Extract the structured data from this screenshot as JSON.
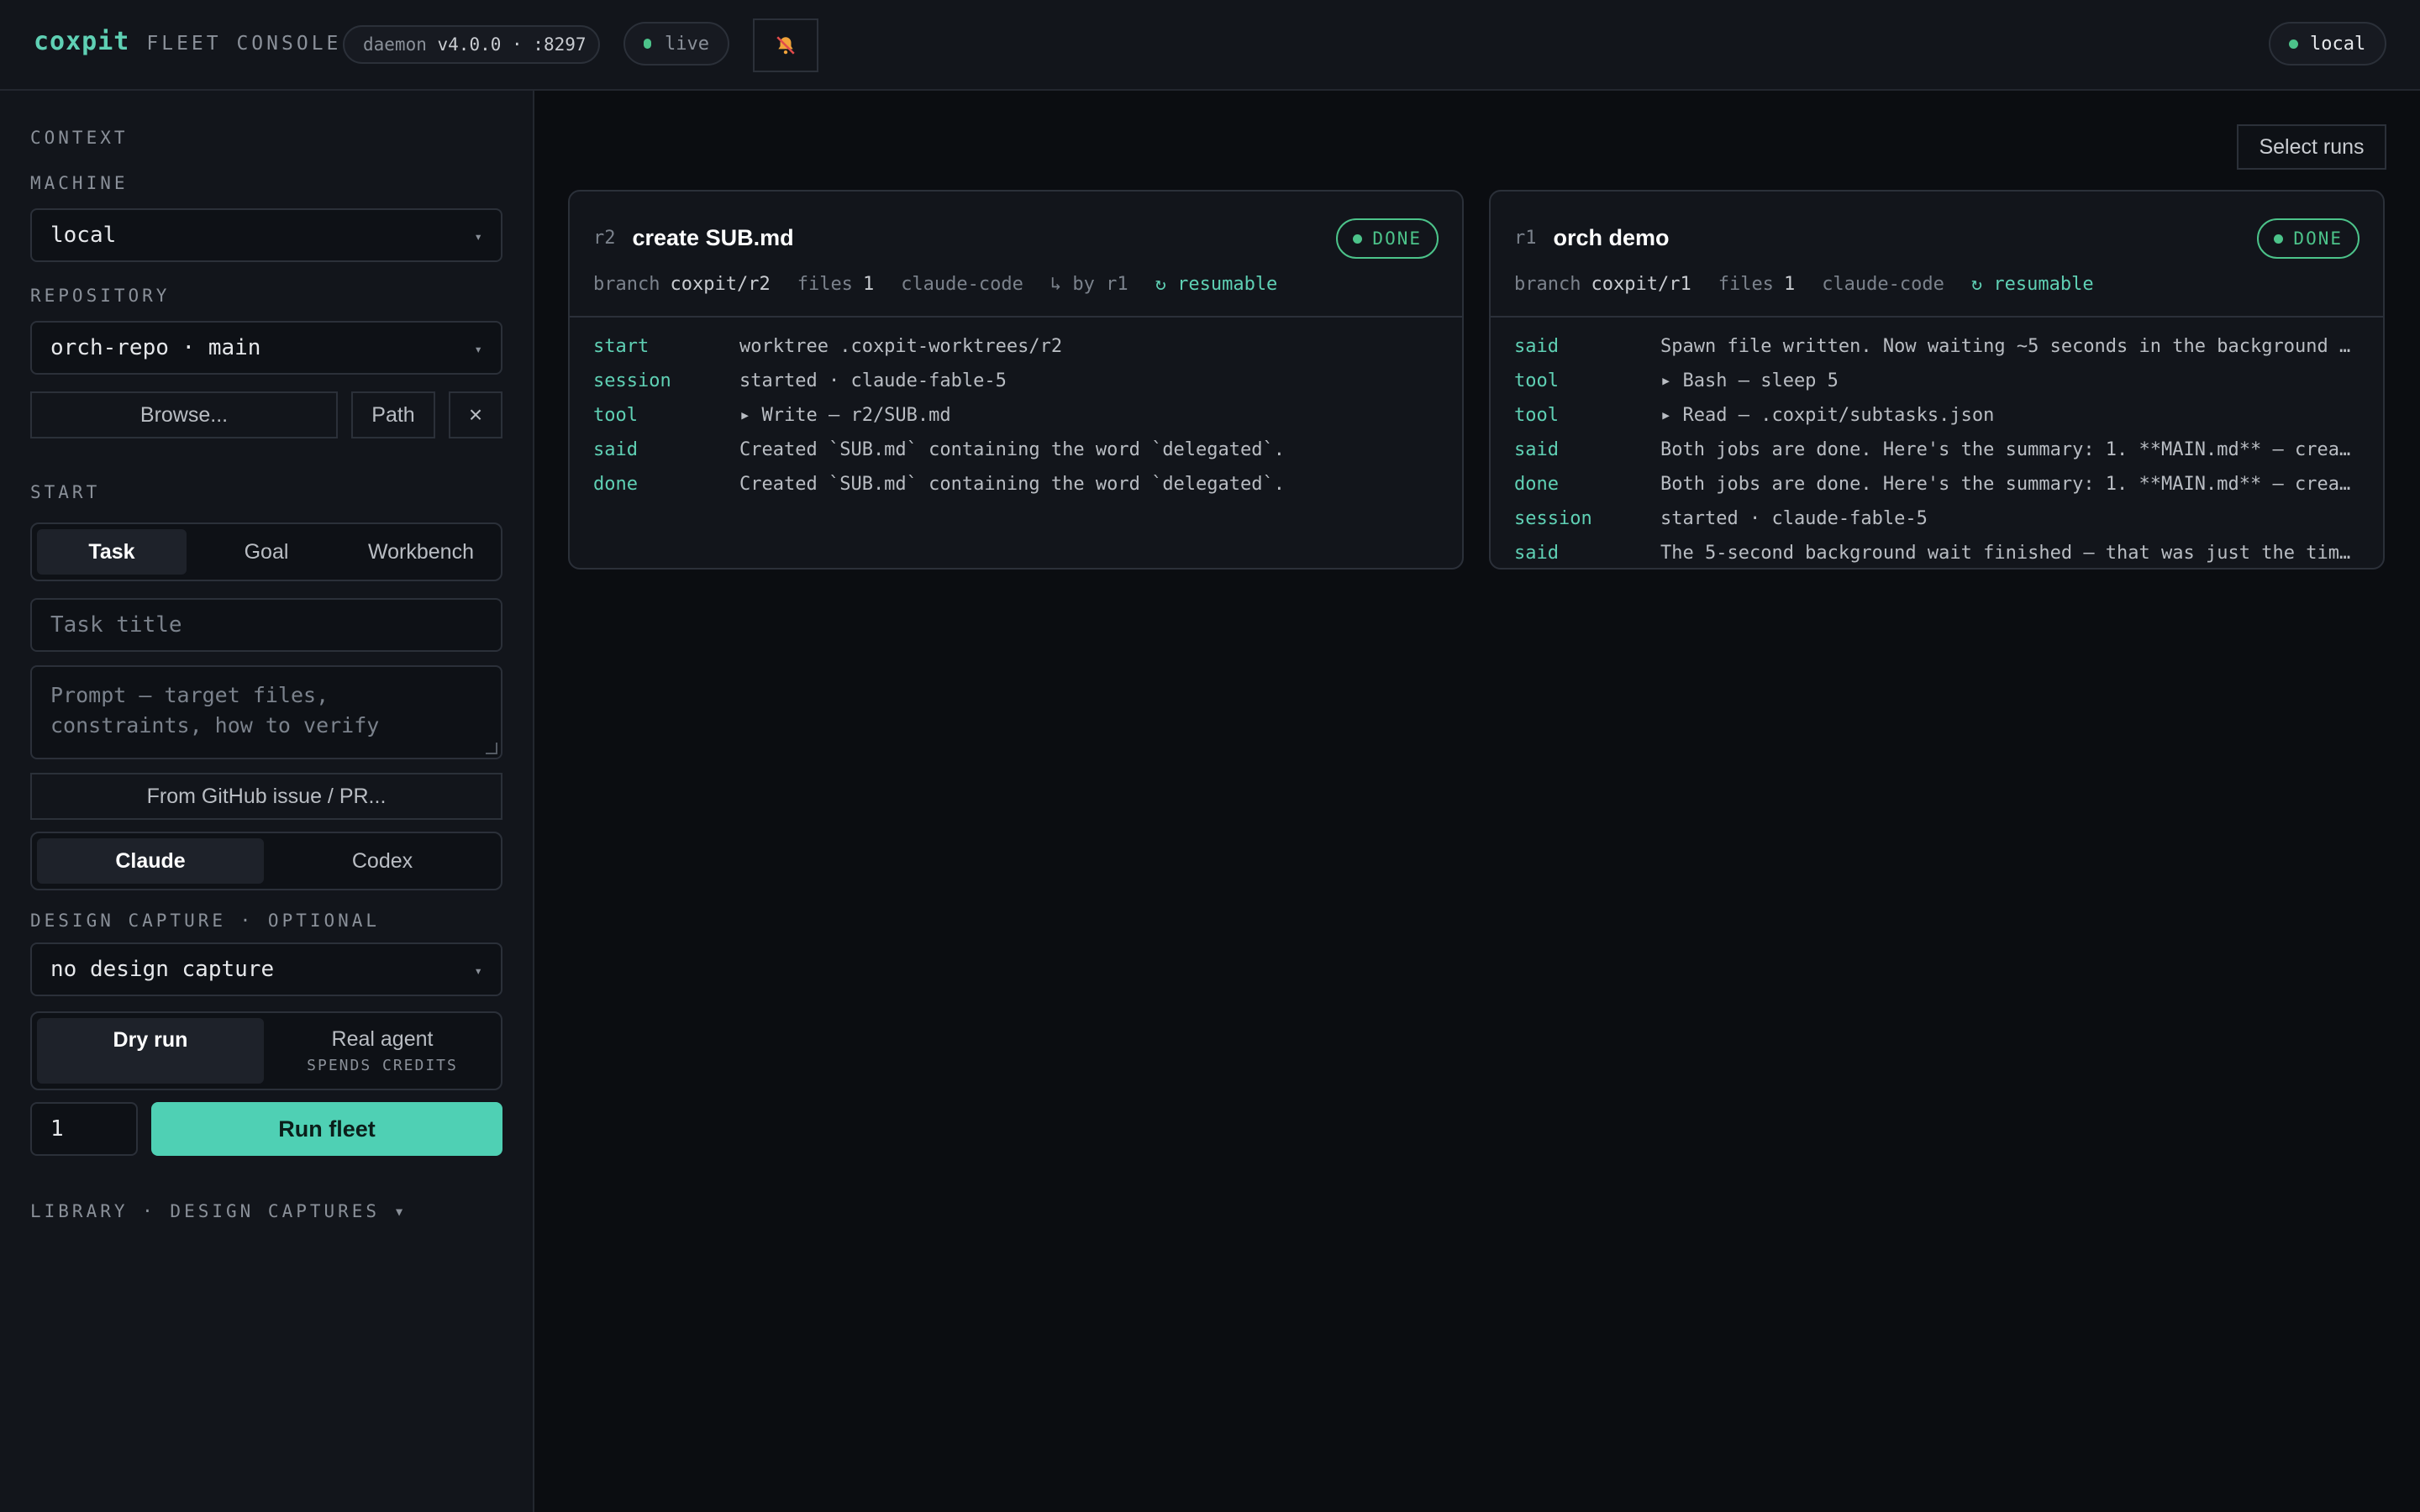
{
  "header": {
    "brand": "coxpit",
    "subtitle": "FLEET CONSOLE",
    "daemon_label": "daemon",
    "daemon_version": "v4.0.0 · :8297",
    "status": "live",
    "status_color": "#4cc38a",
    "mute_icon": "bell-slash-icon",
    "machine_status": "local"
  },
  "sidebar": {
    "context_label": "CONTEXT",
    "machine_label": "MACHINE",
    "machine_value": "local",
    "repository_label": "REPOSITORY",
    "repository_value": "orch-repo · main",
    "browse_label": "Browse...",
    "path_label": "Path",
    "clear_label": "×",
    "start_label": "START",
    "mode_tabs": [
      "Task",
      "Goal",
      "Workbench"
    ],
    "mode_selected": "Task",
    "task_title_placeholder": "Task title",
    "prompt_placeholder": "Prompt — target files, constraints, how to verify",
    "github_label": "From GitHub issue / PR...",
    "agent_tabs": [
      "Claude",
      "Codex"
    ],
    "agent_selected": "Claude",
    "design_capture_label": "DESIGN CAPTURE · OPTIONAL",
    "design_capture_value": "no design capture",
    "run_modes": {
      "dry_run": "Dry run",
      "real_agent": "Real agent",
      "real_agent_sub": "SPENDS CREDITS"
    },
    "count_value": "1",
    "run_label": "Run fleet",
    "library_label": "LIBRARY · DESIGN CAPTURES ▾"
  },
  "main": {
    "select_runs_label": "Select runs",
    "cards": [
      {
        "id": "r2",
        "title": "create SUB.md",
        "status": "DONE",
        "branch_label": "branch",
        "branch": "coxpit/r2",
        "files_label": "files",
        "files": "1",
        "engine": "claude-code",
        "by": "↳ by r1",
        "resumable": "↻ resumable",
        "log": [
          {
            "kind": "start",
            "text": "worktree .coxpit-worktrees/r2"
          },
          {
            "kind": "session",
            "text": "started · claude-fable-5"
          },
          {
            "kind": "tool",
            "text": "▸ Write — r2/SUB.md"
          },
          {
            "kind": "said",
            "text": "Created `SUB.md` containing the word `delegated`."
          },
          {
            "kind": "done",
            "text": "Created `SUB.md` containing the word `delegated`."
          }
        ]
      },
      {
        "id": "r1",
        "title": "orch demo",
        "status": "DONE",
        "branch_label": "branch",
        "branch": "coxpit/r1",
        "files_label": "files",
        "files": "1",
        "engine": "claude-code",
        "resumable": "↻ resumable",
        "log": [
          {
            "kind": "said",
            "text": "Spawn file written. Now waiting ~5 seconds in the background …"
          },
          {
            "kind": "tool",
            "text": "▸ Bash — sleep 5"
          },
          {
            "kind": "tool",
            "text": "▸ Read — .coxpit/subtasks.json"
          },
          {
            "kind": "said",
            "text": "Both jobs are done. Here's the summary: 1. **MAIN.md** — crea…"
          },
          {
            "kind": "done",
            "text": "Both jobs are done. Here's the summary: 1. **MAIN.md** — crea…"
          },
          {
            "kind": "session",
            "text": "started · claude-fable-5"
          },
          {
            "kind": "said",
            "text": "The 5-second background wait finished — that was just the tim…"
          }
        ]
      }
    ]
  }
}
